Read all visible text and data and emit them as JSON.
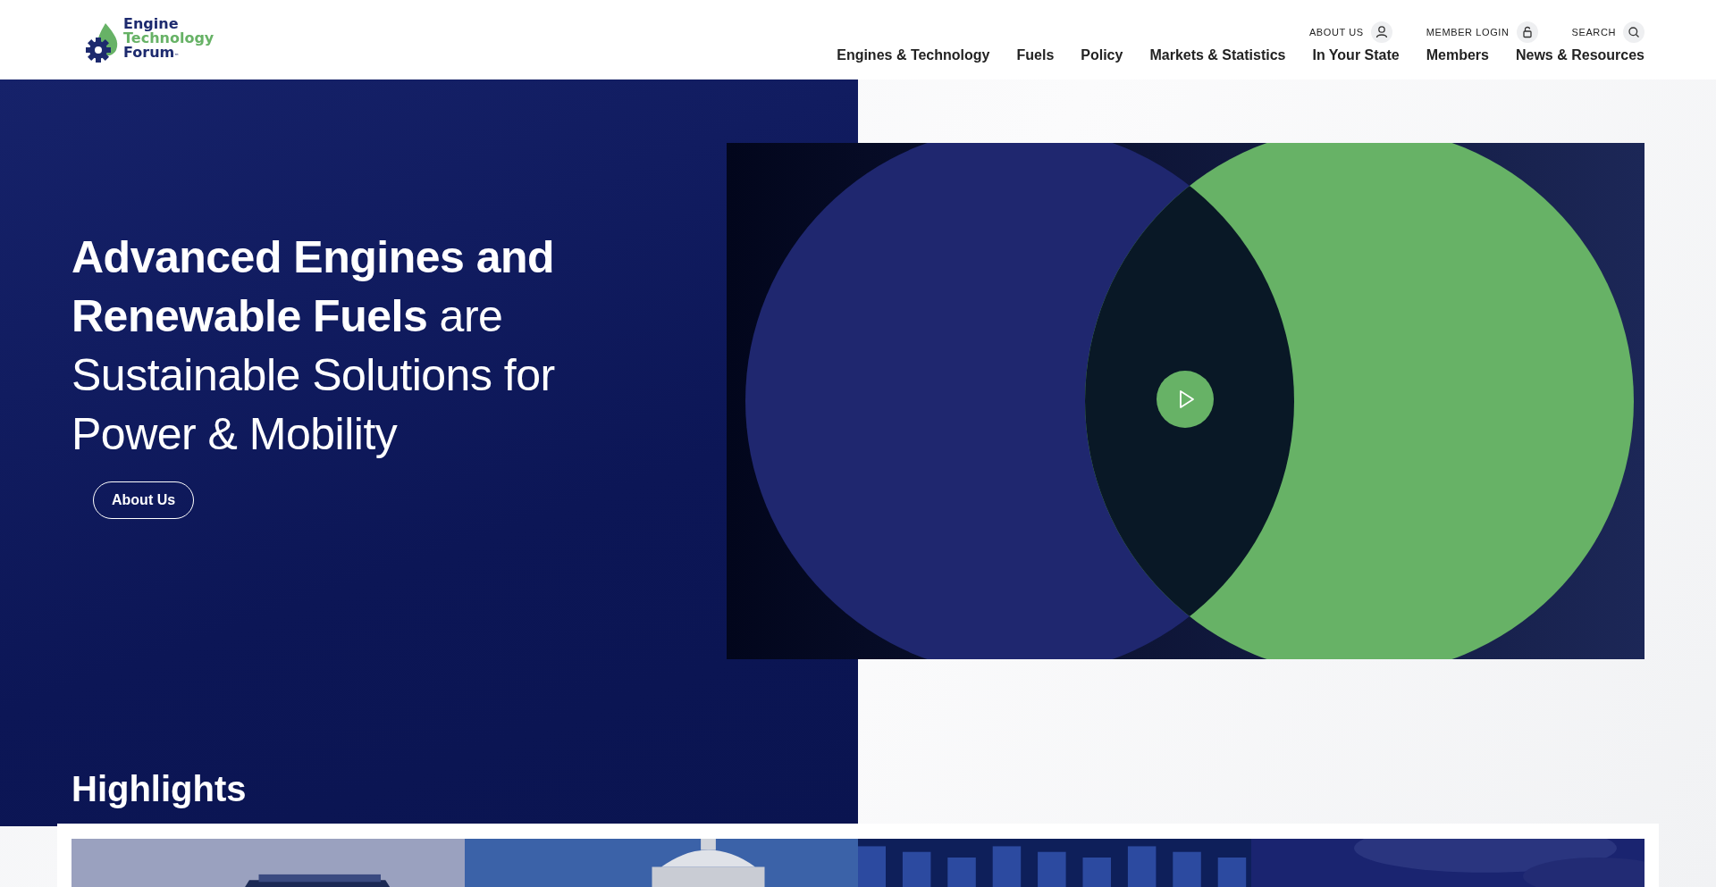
{
  "header": {
    "logo": {
      "lines": [
        "Engine",
        "Technology",
        "Forum"
      ],
      "mark": "™"
    },
    "utility_links": [
      {
        "label": "ABOUT US",
        "kind": "person"
      },
      {
        "label": "MEMBER LOGIN",
        "kind": "lock"
      },
      {
        "label": "SEARCH",
        "kind": "search"
      }
    ],
    "nav": [
      "Engines & Technology",
      "Fuels",
      "Policy",
      "Markets & Statistics",
      "In Your State",
      "Members",
      "News & Resources"
    ]
  },
  "hero": {
    "headline": "**Advanced Engines and Renewable Fuels** are Sustainable Solutions for Power & Mobility",
    "button": "About Us"
  },
  "highlights": {
    "title": "Highlights"
  }
}
